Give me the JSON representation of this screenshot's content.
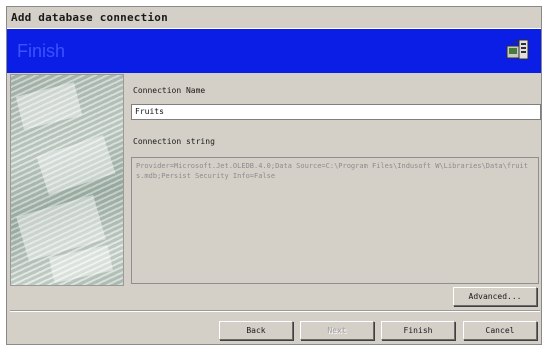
{
  "window": {
    "title": "Add database connection"
  },
  "banner": {
    "title": "Finish",
    "icon": "database-connection-icon"
  },
  "form": {
    "connection_name_label": "Connection Name",
    "connection_name_value": "Fruits",
    "connection_string_label": "Connection string",
    "connection_string_value": "Provider=Microsoft.Jet.OLEDB.4.0;Data Source=C:\\Program Files\\Indusoft W\\Libraries\\Data\\fruits.mdb;Persist Security Info=False"
  },
  "buttons": {
    "advanced": "Advanced...",
    "back": "Back",
    "next": "Next",
    "finish": "Finish",
    "cancel": "Cancel"
  },
  "colors": {
    "banner": "#0a1ee6",
    "banner_text": "#3a52ff",
    "dialog_bg": "#d4d0c8"
  }
}
